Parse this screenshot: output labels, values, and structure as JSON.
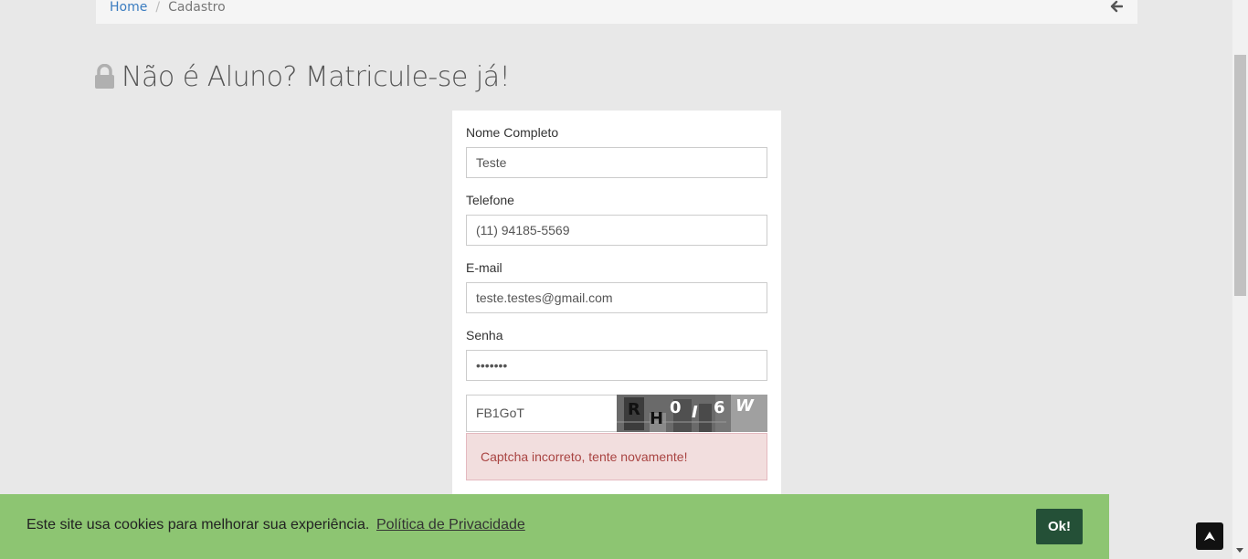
{
  "breadcrumb": {
    "home": "Home",
    "current": "Cadastro"
  },
  "header": {
    "title": "Não é Aluno? Matricule-se já!"
  },
  "form": {
    "name_label": "Nome Completo",
    "name_value": "Teste",
    "phone_label": "Telefone",
    "phone_value": "(11) 94185-5569",
    "email_label": "E-mail",
    "email_value": "teste.testes@gmail.com",
    "password_label": "Senha",
    "password_value": "•••••••",
    "captcha_value": "FB1GoT",
    "captcha_chars": [
      "R",
      "H",
      "0",
      "I",
      "6",
      "W"
    ],
    "error": "Captcha incorreto, tente novamente!"
  },
  "cookie": {
    "message": "Este site usa cookies para melhorar sua experiência.",
    "policy_link": "Política de Privacidade",
    "ok_button": "Ok!"
  },
  "colors": {
    "cookie_bg": "#8dc572",
    "ok_button_bg": "#245037",
    "error_bg": "#f2dede",
    "error_text": "#a94442",
    "link": "#3a7cc0"
  },
  "icons": [
    "arrow-left-icon",
    "lock-icon",
    "chevron-up-icon"
  ]
}
